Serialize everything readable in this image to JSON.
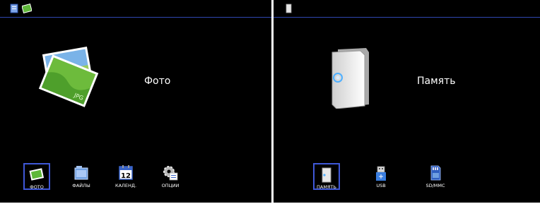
{
  "left_screen": {
    "hero_label": "Фото",
    "dock": [
      {
        "label": "ФОТО",
        "icon": "photo-icon",
        "selected": true
      },
      {
        "label": "ФАЙЛЫ",
        "icon": "files-icon",
        "selected": false
      },
      {
        "label": "КАЛЕНД.",
        "icon": "calendar-icon",
        "selected": false
      },
      {
        "label": "ОПЦИИ",
        "icon": "settings-icon",
        "selected": false
      }
    ],
    "calendar_day": "12",
    "photo_badge": "JPG"
  },
  "right_screen": {
    "hero_label": "Память",
    "dock": [
      {
        "label": "ПАМЯТЬ",
        "icon": "memory-icon",
        "selected": true
      },
      {
        "label": "USB",
        "icon": "usb-icon",
        "selected": false
      },
      {
        "label": "SD/MMC",
        "icon": "sd-card-icon",
        "selected": false
      }
    ]
  },
  "colors": {
    "background": "#000000",
    "accent_blue": "#3f58d8",
    "text": "#ffffff"
  }
}
